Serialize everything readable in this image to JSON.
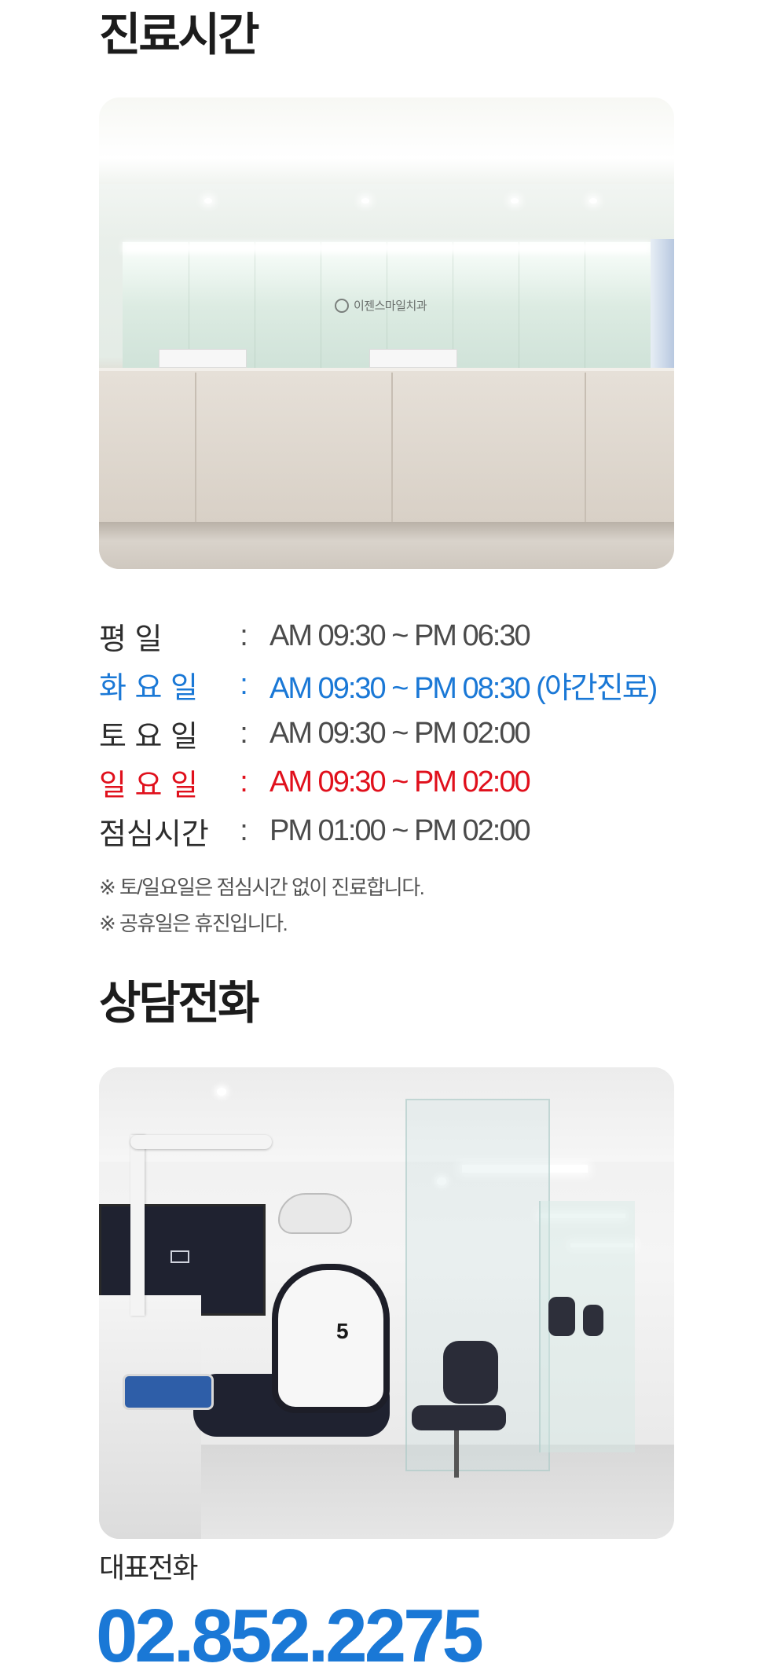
{
  "hours_section": {
    "title": "진료시간",
    "reception_sign": "이젠스마일치과"
  },
  "schedule": [
    {
      "day": "평  일",
      "colon": ":",
      "time": "AM 09:30 ~ PM 06:30",
      "style": "normal"
    },
    {
      "day": "화 요 일",
      "colon": ":",
      "time": "AM 09:30 ~ PM 08:30 (야간진료)",
      "style": "tuesday"
    },
    {
      "day": "토 요 일",
      "colon": ":",
      "time": "AM 09:30 ~ PM 02:00",
      "style": "normal"
    },
    {
      "day": "일 요 일",
      "colon": ":",
      "time": "AM 09:30 ~ PM 02:00",
      "style": "sunday"
    },
    {
      "day": "점심시간",
      "colon": ":",
      "time": "PM 01:00 ~ PM 02:00",
      "style": "normal"
    }
  ],
  "notes": [
    "※ 토/일요일은 점심시간 없이 진료합니다.",
    "※ 공휴일은 휴진입니다."
  ],
  "consult_section": {
    "title": "상담전화",
    "chair_number": "5",
    "phone_label": "대표전화",
    "phone_number": "02.852.2275"
  },
  "colors": {
    "accent_blue": "#1a78d6",
    "sunday_red": "#e0101c",
    "text_dark": "#1c1c1c",
    "text_gray": "#4b4b4b"
  }
}
